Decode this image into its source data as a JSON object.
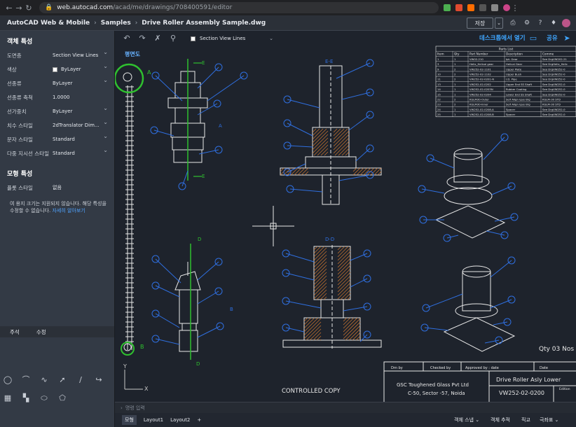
{
  "browser": {
    "url_host": "web.autocad.com",
    "url_path": "/acad/me/drawings/708400591/editor"
  },
  "header": {
    "crumbs": [
      "AutoCAD Web & Mobile",
      "Samples",
      "Drive Roller Assembly Sample.dwg"
    ],
    "save_label": "저장"
  },
  "properties": {
    "section_title": "객체 특성",
    "rows": [
      {
        "label": "도면층",
        "value": "Section View Lines"
      },
      {
        "label": "색상",
        "value": "ByLayer"
      },
      {
        "label": "선종류",
        "value": "ByLayer"
      },
      {
        "label": "선종류 축척",
        "value": "1.0000"
      },
      {
        "label": "선가중치",
        "value": "ByLayer"
      },
      {
        "label": "치수 스타일",
        "value": "2dTranslator Dim..."
      },
      {
        "label": "문자 스타일",
        "value": "Standard"
      },
      {
        "label": "다중 지시선 스타일",
        "value": "Standard"
      }
    ],
    "model_section_title": "모형 특성",
    "plot_style_label": "플롯 스타일",
    "plot_style_value": "없음",
    "note": "여 용지 크기는 지원되지 않습니다. 해당 특성을 수정할 수 없습니다.",
    "note_link": "자세히 알아보기"
  },
  "tool_tabs": [
    "주석",
    "수정"
  ],
  "canvas": {
    "layer_name": "Section View Lines",
    "open_desktop": "데스크톱에서 열기",
    "share": "공유",
    "view_label": "평면도",
    "section_labels": {
      "E": "E",
      "D": "D",
      "A": "A",
      "B": "B",
      "EE": "E-E",
      "DD": "D-D"
    },
    "parts_list_title": "Parts List",
    "parts_headers": [
      "Item",
      "Qty",
      "Part Number",
      "Description",
      "Comme"
    ],
    "parts_rows": [
      [
        "1",
        "1",
        "VW02-210",
        "Ipt. Gear",
        "See DrgVW202-21"
      ],
      [
        "3",
        "1",
        "Helix_Helical gear",
        "Helical Gear",
        "See DrgHelix_Helic"
      ],
      [
        "9",
        "2",
        "VW252-02-1101",
        "Upper Plate",
        "See DrgVW252-0"
      ],
      [
        "10",
        "2",
        "VW252-02-1102",
        "Upper Bush",
        "See DrgVW252-0"
      ],
      [
        "11",
        "2",
        "VW252-02-0201-N",
        "I.D. Pipe",
        "See DrgVW252-0"
      ],
      [
        "13",
        "1",
        "VW252-02-0202",
        "Upper End SS Shaft",
        "See DrgVW252-0"
      ],
      [
        "14",
        "1",
        "VW252-02-0203N",
        "Rubber Coating",
        "See DrgVW252-0"
      ],
      [
        "15",
        "1",
        "VW252-02-0204",
        "Lower End SS Shaft",
        "See DrgVW252-0"
      ],
      [
        "22",
        "2",
        "KGLM30-Outer",
        "Self Align Igus Brg",
        "KGLM-30 STD"
      ],
      [
        "23",
        "2",
        "KGLM30-Inner",
        "Self Align Igus Brg",
        "KGLM-30 STD"
      ],
      [
        "24",
        "1",
        "VW252-02-0208-A",
        "Spacer",
        "See DrgVW252-0"
      ],
      [
        "25",
        "1",
        "VW252-02-0208-B",
        "Spacer",
        "See DrgVW252-0"
      ]
    ],
    "qty_text": "Qty  03 Nos",
    "controlled_copy": "CONTROLLED COPY",
    "title_block": {
      "drn_by": "Drn by",
      "checked_by": "Checked by",
      "approved_by": "Approved by : date",
      "date": "Date",
      "company": "GSC Toughened Glass Pvt Ltd",
      "address": "C-50, Sector -57, Noida",
      "drawing_title": "Drive Roller Asly Lower",
      "drawing_number": "VW252-02-0200",
      "edition": "Edition"
    }
  },
  "command_placeholder": "명령 입력",
  "status": {
    "tabs": [
      "모형",
      "Layout1",
      "Layout2"
    ],
    "snap": "객체 스냅",
    "track": "객체 추적",
    "ortho": "직교",
    "polar": "극좌표"
  },
  "colors": {
    "accent": "#3fa6ff",
    "drawing_blue": "#2f6fe0",
    "drawing_green": "#2fc02f",
    "drawing_white": "#e8e8e8"
  }
}
